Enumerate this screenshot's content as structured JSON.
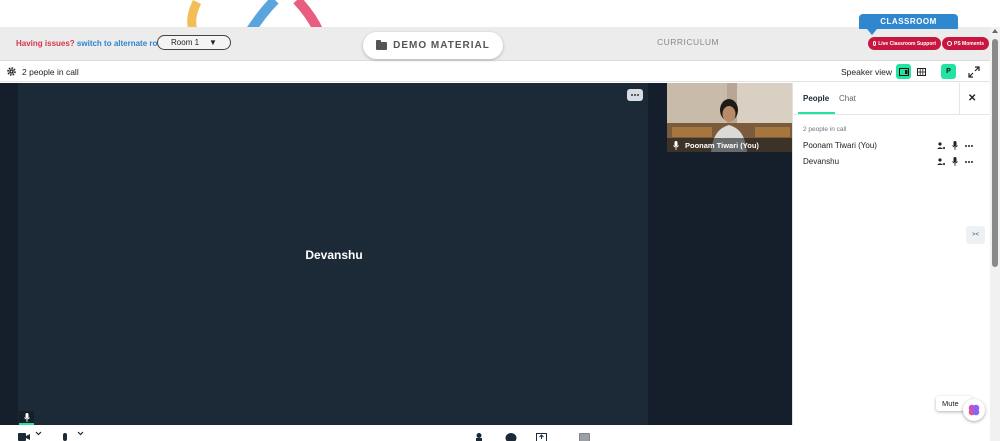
{
  "header": {
    "issues_text": "Having issues?",
    "alternate_link": "switch to alternate room",
    "room_select": "Room 1",
    "demo_material": "DEMO MATERIAL",
    "curriculum": "CURRICULUM",
    "classroom_tab": "CLASSROOM",
    "live_support": "Live Classroom Support",
    "ps_moments": "PS Moments"
  },
  "callbar": {
    "people_count": "2 people in call",
    "view_label": "Speaker view",
    "participant_badge": "P"
  },
  "main": {
    "speaker_name": "Devanshu",
    "thumbnail_name": "Poonam Tiwari (You)"
  },
  "panel": {
    "tab_people": "People",
    "tab_chat": "Chat",
    "in_call": "2 people in call",
    "people": [
      {
        "name": "Poonam Tiwari (You)"
      },
      {
        "name": "Devanshu"
      }
    ]
  },
  "controls": {
    "mute": "Mute"
  },
  "colors": {
    "accent": "#22e3a1",
    "video_bg": "#1c2a38",
    "brand_red": "#c8173f",
    "brand_blue": "#2f87cf"
  }
}
